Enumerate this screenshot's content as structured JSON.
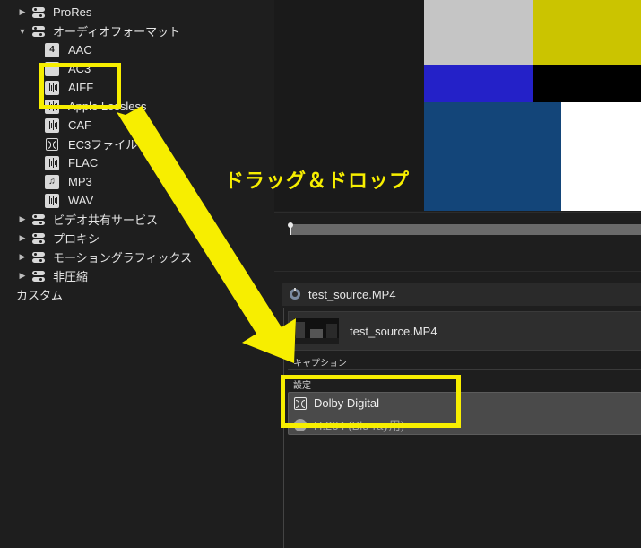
{
  "sidebar": {
    "groups": [
      {
        "label": "ProRes",
        "expanded": false,
        "icon": "preset-group-icon"
      },
      {
        "label": "オーディオフォーマット",
        "expanded": true,
        "icon": "preset-group-icon"
      },
      {
        "label": "ビデオ共有サービス",
        "expanded": false,
        "icon": "preset-group-icon"
      },
      {
        "label": "プロキシ",
        "expanded": false,
        "icon": "preset-group-icon"
      },
      {
        "label": "モーショングラフィックス",
        "expanded": false,
        "icon": "preset-group-icon"
      },
      {
        "label": "非圧縮",
        "expanded": false,
        "icon": "preset-group-icon"
      }
    ],
    "audio_items": [
      {
        "label": "AAC",
        "icon": "aac-icon",
        "badge": "4"
      },
      {
        "label": "AC3",
        "icon": "ac3-icon"
      },
      {
        "label": "AIFF",
        "icon": "waveform-icon"
      },
      {
        "label": "Apple Lossless",
        "icon": "waveform-icon"
      },
      {
        "label": "CAF",
        "icon": "waveform-icon"
      },
      {
        "label": "EC3ファイル",
        "icon": "dolby-icon"
      },
      {
        "label": "FLAC",
        "icon": "waveform-icon"
      },
      {
        "label": "MP3",
        "icon": "music-note-icon"
      },
      {
        "label": "WAV",
        "icon": "waveform-icon"
      }
    ],
    "custom_label": "カスタム"
  },
  "viewer": {
    "colors": [
      "#c5c5c5",
      "#cbc400",
      "#2421c8",
      "#000000",
      "#134579",
      "#ffffff"
    ]
  },
  "batch": {
    "job_title": "test_source.MP4",
    "file_name": "test_source.MP4",
    "caption_section": "キャプション",
    "settings_section": "設定",
    "setting_main": "Dolby Digital",
    "setting_sub": "H.264 (Blu-ray用)"
  },
  "annotation": {
    "text": "ドラッグ＆ドロップ",
    "color": "#f7ee00"
  }
}
